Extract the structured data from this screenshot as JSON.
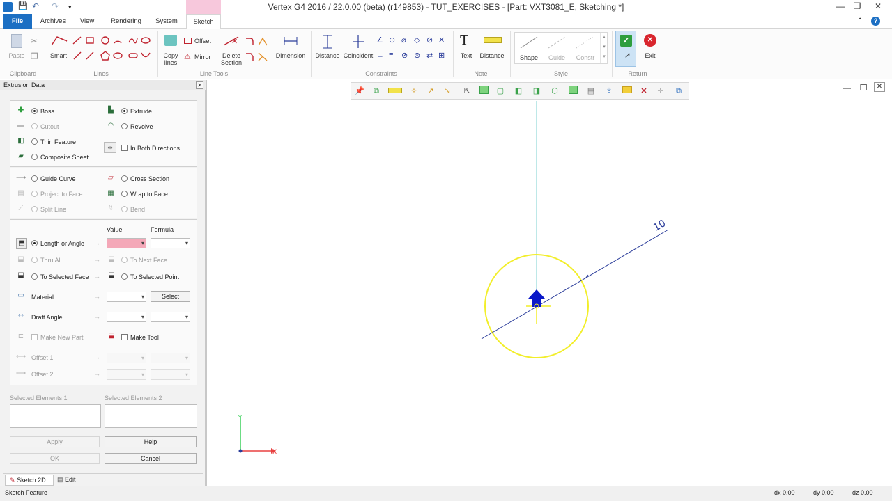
{
  "window": {
    "title": "Vertex G4 2016 / 22.0.00 (beta) (r149853) - TUT_EXERCISES - [Part: VXT3081_E, Sketching *]",
    "minimize": "—",
    "restore": "❐",
    "close": "✕"
  },
  "qat": {
    "app_icon": "app-icon",
    "save": "💾",
    "undo": "↶",
    "redo": "↷",
    "more": "▾"
  },
  "menu": {
    "file": "File",
    "tabs": [
      "Archives",
      "View",
      "Rendering",
      "System",
      "Sketch"
    ],
    "help_icon": "?",
    "collapse_icon": "⌃"
  },
  "ribbon": {
    "clipboard": {
      "paste": "Paste",
      "label": "Clipboard"
    },
    "lines": {
      "smart": "Smart",
      "label": "Lines"
    },
    "line_tools": {
      "offset": "Offset",
      "copy_lines": "Copy lines",
      "mirror": "Mirror",
      "delete_section": "Delete Section",
      "label": "Line Tools"
    },
    "dimension": "Dimension",
    "constraints": {
      "distance": "Distance",
      "coincident": "Coincident",
      "label": "Constraints"
    },
    "note": {
      "text": "Text",
      "distance": "Distance",
      "label": "Note"
    },
    "style": {
      "shape": "Shape",
      "guide": "Guide",
      "constr": "Constr",
      "label": "Style"
    },
    "return": {
      "exit": "Exit",
      "label": "Return"
    },
    "colors": {
      "accept": "#2e9e3e",
      "exit": "#d9262e"
    }
  },
  "panel": {
    "title": "Extrusion Data",
    "close": "✕",
    "type": {
      "boss": "Boss",
      "cutout": "Cutout",
      "thin": "Thin Feature",
      "composite": "Composite Sheet",
      "extrude": "Extrude",
      "revolve": "Revolve",
      "both_dirs": "In Both Directions"
    },
    "path": {
      "guide_curve": "Guide Curve",
      "project": "Project to Face",
      "split": "Split Line",
      "cross": "Cross Section",
      "wrap": "Wrap to Face",
      "bend": "Bend"
    },
    "params": {
      "value_header": "Value",
      "formula_header": "Formula",
      "length": "Length or Angle",
      "thru": "Thru All",
      "next_face": "To Next Face",
      "sel_face": "To Selected Face",
      "sel_point": "To Selected Point",
      "material": "Material",
      "select": "Select",
      "draft": "Draft Angle",
      "new_part": "Make New Part",
      "make_tool": "Make Tool",
      "offset1": "Offset 1",
      "offset2": "Offset 2"
    },
    "selected1": "Selected Elements 1",
    "selected2": "Selected Elements 2",
    "apply": "Apply",
    "help": "Help",
    "ok": "OK",
    "cancel": "Cancel",
    "tabs": [
      "Sketch 2D",
      "Edit"
    ]
  },
  "viewport": {
    "dimension_value": "10",
    "axis_x": "X",
    "axis_y": "Y",
    "colors": {
      "circle": "#f2ee2a",
      "line": "#2a3c9a",
      "axis": "#7cd2d2",
      "arrow": "#0a18c8"
    }
  },
  "status": {
    "left": "Sketch Feature",
    "dx": "dx 0.00",
    "dy": "dy 0.00",
    "dz": "dz 0.00"
  }
}
